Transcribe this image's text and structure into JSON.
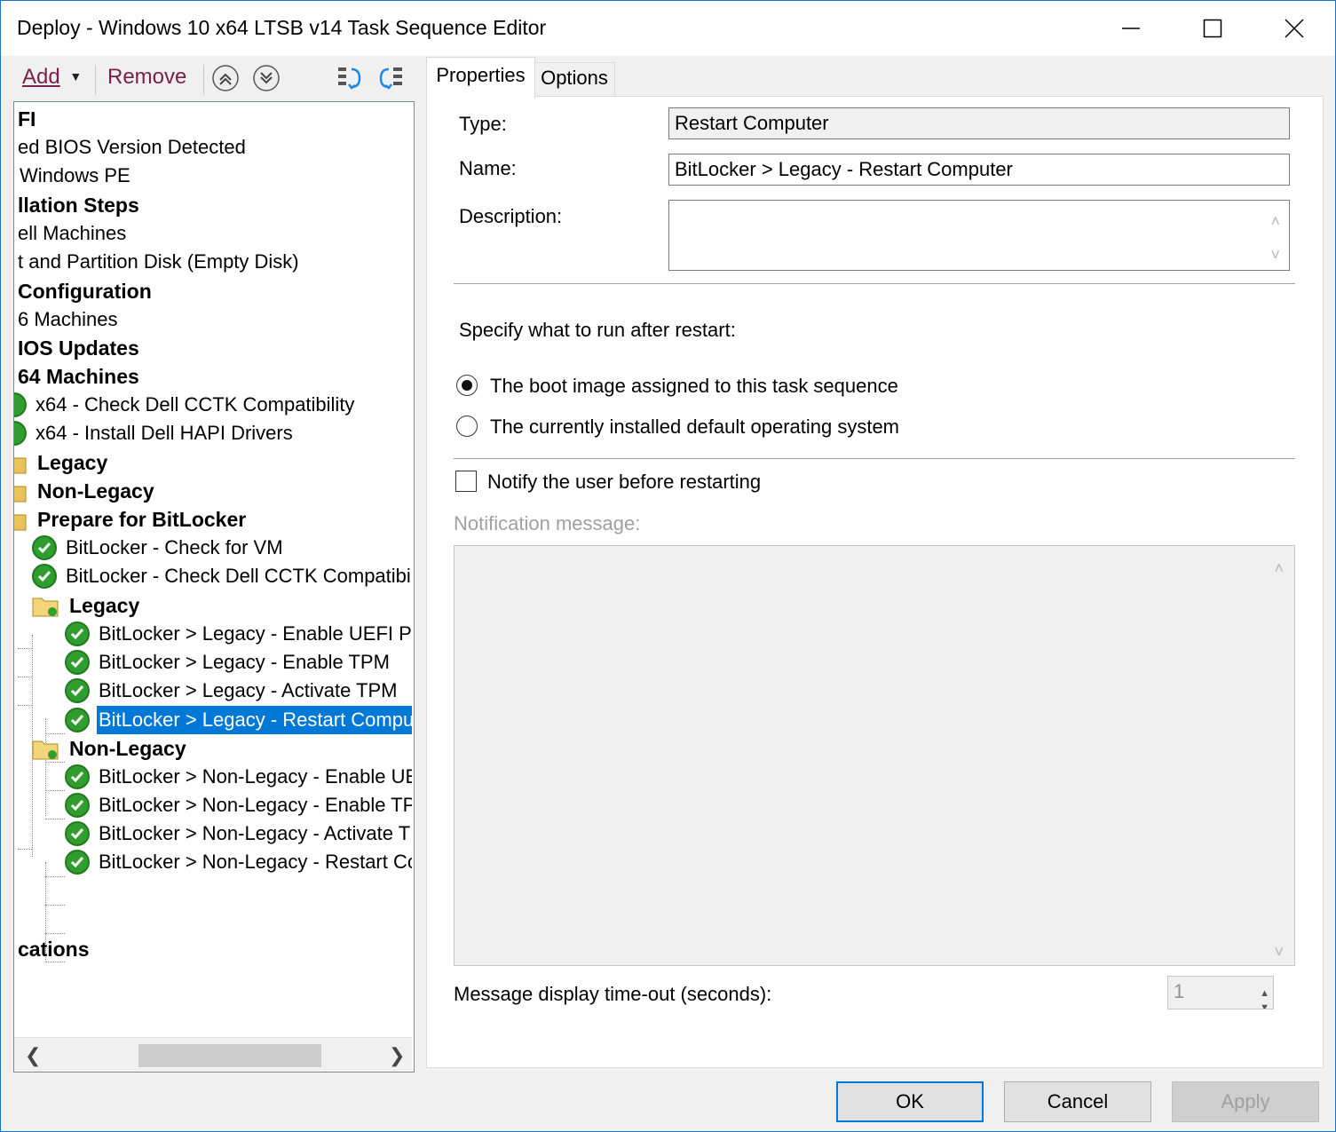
{
  "window": {
    "title": "Deploy - Windows 10 x64 LTSB v14 Task Sequence Editor"
  },
  "toolbar": {
    "add_label": "Add",
    "remove_label": "Remove"
  },
  "tree": {
    "items": [
      {
        "label": "FI",
        "bold": true
      },
      {
        "label": "ed BIOS Version Detected",
        "bold": false
      },
      {
        "label": "Windows PE",
        "bold": false
      },
      {
        "label": "llation Steps",
        "bold": true
      },
      {
        "label": "ell Machines",
        "bold": false
      },
      {
        "label": "t and Partition Disk (Empty Disk)",
        "bold": false
      },
      {
        "label": "Configuration",
        "bold": true
      },
      {
        "label": "6 Machines",
        "bold": false
      },
      {
        "label": "IOS Updates",
        "bold": true
      },
      {
        "label": "64 Machines",
        "bold": true
      },
      {
        "label": "x64 - Check Dell CCTK Compatibility",
        "bold": false
      },
      {
        "label": "x64 - Install Dell HAPI Drivers",
        "bold": false
      },
      {
        "label": "Legacy",
        "bold": true
      },
      {
        "label": "Non-Legacy",
        "bold": true
      },
      {
        "label": "Prepare for BitLocker",
        "bold": true
      },
      {
        "label": "BitLocker - Check for VM",
        "bold": false
      },
      {
        "label": "BitLocker - Check Dell CCTK Compatibilit",
        "bold": false
      },
      {
        "label": "Legacy",
        "bold": true
      },
      {
        "label": "BitLocker > Legacy - Enable UEFI P)",
        "bold": false
      },
      {
        "label": "BitLocker > Legacy - Enable TPM",
        "bold": false
      },
      {
        "label": "BitLocker > Legacy - Activate TPM",
        "bold": false
      },
      {
        "label": "BitLocker > Legacy - Restart Comput",
        "bold": false,
        "selected": true
      },
      {
        "label": "Non-Legacy",
        "bold": true
      },
      {
        "label": "BitLocker > Non-Legacy - Enable UE",
        "bold": false
      },
      {
        "label": "BitLocker > Non-Legacy - Enable TP",
        "bold": false
      },
      {
        "label": "BitLocker > Non-Legacy - Activate T",
        "bold": false
      },
      {
        "label": "BitLocker > Non-Legacy - Restart Co",
        "bold": false
      },
      {
        "label": "cations",
        "bold": true
      }
    ]
  },
  "tabs": {
    "properties": "Properties",
    "options": "Options"
  },
  "properties": {
    "type_label": "Type:",
    "type_value": "Restart Computer",
    "name_label": "Name:",
    "name_value": "BitLocker > Legacy - Restart Computer",
    "description_label": "Description:",
    "description_value": "",
    "specify_label": "Specify what to run after restart:",
    "radio_boot_image": "The boot image assigned to this task sequence",
    "radio_boot_image_selected": true,
    "radio_default_os": "The currently installed default operating system",
    "radio_default_os_selected": false,
    "notify_label": "Notify the user before restarting",
    "notify_checked": false,
    "notification_message_label": "Notification message:",
    "notification_message_value": "",
    "timeout_label": "Message display time-out (seconds):",
    "timeout_value": "1"
  },
  "buttons": {
    "ok": "OK",
    "cancel": "Cancel",
    "apply": "Apply"
  },
  "colors": {
    "selection": "#0078d7",
    "toolbar_text": "#7a1f4a",
    "check_green": "#2f9e2f"
  }
}
